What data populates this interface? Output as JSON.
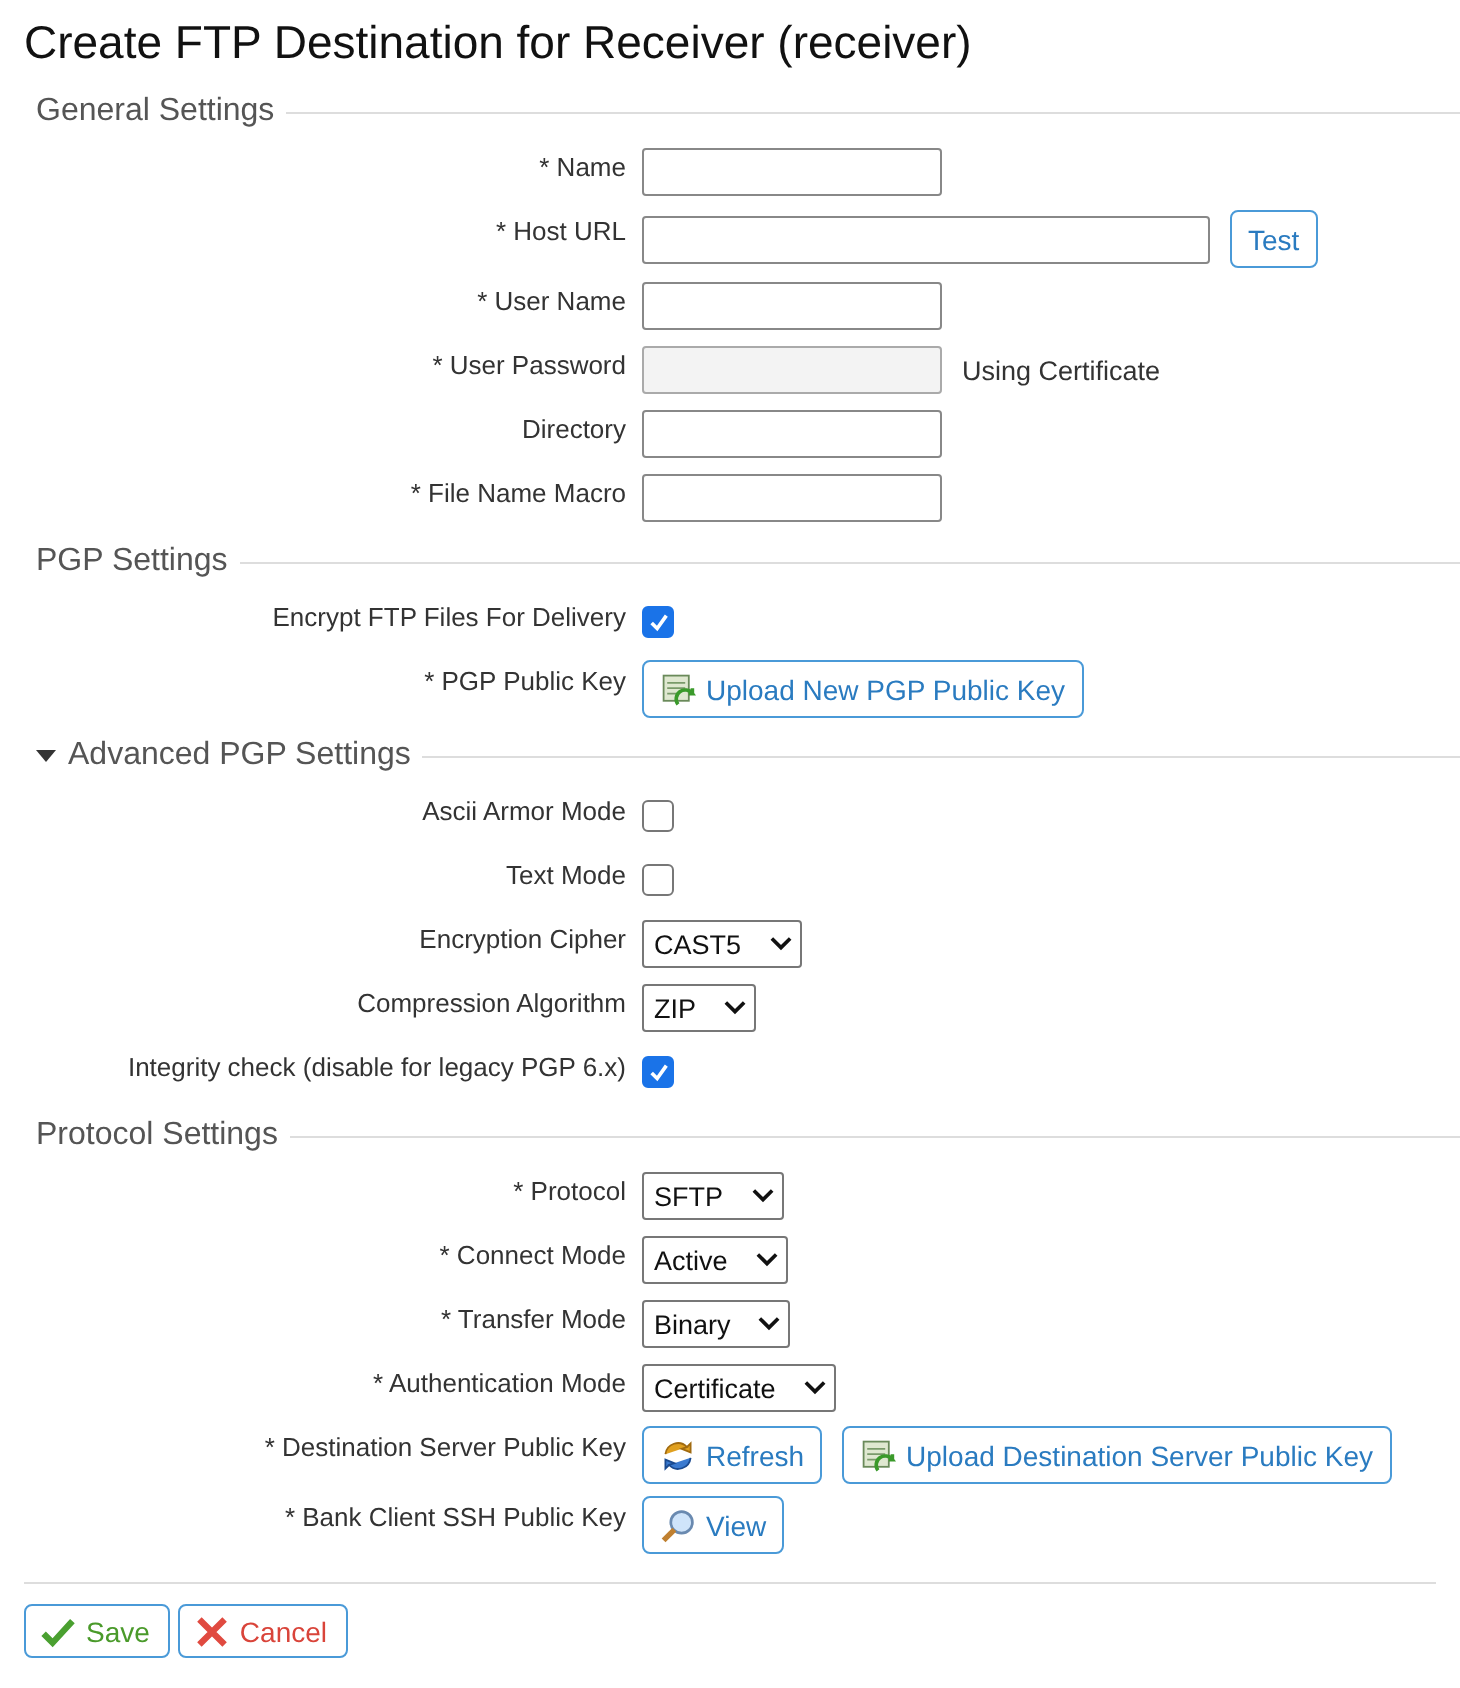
{
  "title": "Create FTP Destination for Receiver (receiver)",
  "sections": [
    {
      "heading": "General Settings",
      "rows": [
        {
          "label": "* Name",
          "controls": [
            {
              "kind": "input",
              "disabled": false,
              "wide": false
            }
          ]
        },
        {
          "label": "* Host URL",
          "controls": [
            {
              "kind": "input",
              "disabled": false,
              "wide": true
            },
            {
              "kind": "button",
              "label": "Test"
            }
          ]
        },
        {
          "label": "* User Name",
          "controls": [
            {
              "kind": "input",
              "disabled": false,
              "wide": false
            }
          ]
        },
        {
          "label": "* User Password",
          "controls": [
            {
              "kind": "input",
              "disabled": true,
              "wide": false
            },
            {
              "kind": "note",
              "text": "Using Certificate"
            }
          ]
        },
        {
          "label": "Directory",
          "controls": [
            {
              "kind": "input",
              "disabled": false,
              "wide": false
            }
          ]
        },
        {
          "label": "* File Name Macro",
          "controls": [
            {
              "kind": "input",
              "disabled": false,
              "wide": false
            }
          ]
        }
      ]
    },
    {
      "heading": "PGP Settings",
      "rows": [
        {
          "label": "Encrypt FTP Files For Delivery",
          "controls": [
            {
              "kind": "checkbox",
              "checked": true
            }
          ]
        },
        {
          "label": "* PGP Public Key",
          "controls": [
            {
              "kind": "upload-button",
              "label": "Upload New PGP Public Key"
            }
          ]
        }
      ]
    },
    {
      "heading": "Advanced PGP Settings",
      "expanded": true,
      "rows": [
        {
          "label": "Ascii Armor Mode",
          "controls": [
            {
              "kind": "checkbox",
              "checked": false
            }
          ]
        },
        {
          "label": "Text Mode",
          "controls": [
            {
              "kind": "checkbox",
              "checked": false
            }
          ]
        },
        {
          "label": "Encryption Cipher",
          "controls": [
            {
              "kind": "select",
              "value": "CAST5"
            }
          ]
        },
        {
          "label": "Compression Algorithm",
          "controls": [
            {
              "kind": "select",
              "value": "ZIP"
            }
          ]
        },
        {
          "label": "Integrity check (disable for legacy PGP 6.x)",
          "controls": [
            {
              "kind": "checkbox",
              "checked": true
            }
          ]
        }
      ]
    },
    {
      "heading": "Protocol Settings",
      "rows": [
        {
          "label": "* Protocol",
          "controls": [
            {
              "kind": "select",
              "value": "SFTP"
            }
          ]
        },
        {
          "label": "* Connect Mode",
          "controls": [
            {
              "kind": "select",
              "value": "Active"
            }
          ]
        },
        {
          "label": "* Transfer Mode",
          "controls": [
            {
              "kind": "select",
              "value": "Binary"
            }
          ]
        },
        {
          "label": "* Authentication Mode",
          "controls": [
            {
              "kind": "select",
              "value": "Certificate"
            }
          ]
        },
        {
          "label": "* Destination Server Public Key",
          "controls": [
            {
              "kind": "refresh-button",
              "label": "Refresh"
            },
            {
              "kind": "upload-button",
              "label": "Upload Destination Server Public Key"
            }
          ]
        },
        {
          "label": "* Bank Client SSH Public Key",
          "controls": [
            {
              "kind": "view-button",
              "label": "View"
            }
          ]
        }
      ]
    }
  ],
  "actions": [
    {
      "kind": "save",
      "label": "Save"
    },
    {
      "kind": "cancel",
      "label": "Cancel"
    }
  ]
}
